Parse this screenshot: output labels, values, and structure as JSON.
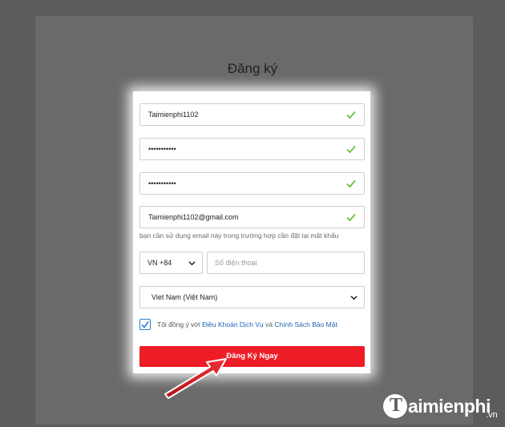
{
  "page": {
    "title": "Đăng ký"
  },
  "form": {
    "username": {
      "value": "Taimienphi1102",
      "valid": true
    },
    "password": {
      "value": "•••••••••••",
      "valid": true
    },
    "confirm_password": {
      "value": "•••••••••••",
      "valid": true
    },
    "email": {
      "value": "Taimienphi1102@gmail.com",
      "valid": true
    },
    "email_hint": "bạn cần sử dụng email này trong trường hợp cần đặt lại mật khẩu",
    "country_code": {
      "selected": "VN +84"
    },
    "phone": {
      "value": "",
      "placeholder": "Số điện thoại"
    },
    "country": {
      "selected": "Viet Nam (Việt Nam)"
    },
    "agree": {
      "checked": true,
      "prefix": "Tôi đồng ý với",
      "terms_link": "Điều Khoản Dịch Vụ",
      "conjunction": "và",
      "privacy_link": "Chính Sách Bảo Mật"
    },
    "submit_label": "Đăng Ký Ngay"
  },
  "watermark": {
    "mark": "T",
    "word": "aimienphi",
    "tld": ".vn"
  },
  "colors": {
    "accent_red": "#ee1c25",
    "valid_green": "#6cc04a",
    "link_blue": "#1f63b6",
    "overlay_gray": "#5c5c5c"
  },
  "icons": {
    "valid": "check-icon",
    "dropdown": "chevron-down-icon",
    "annotation": "red-arrow-icon"
  }
}
